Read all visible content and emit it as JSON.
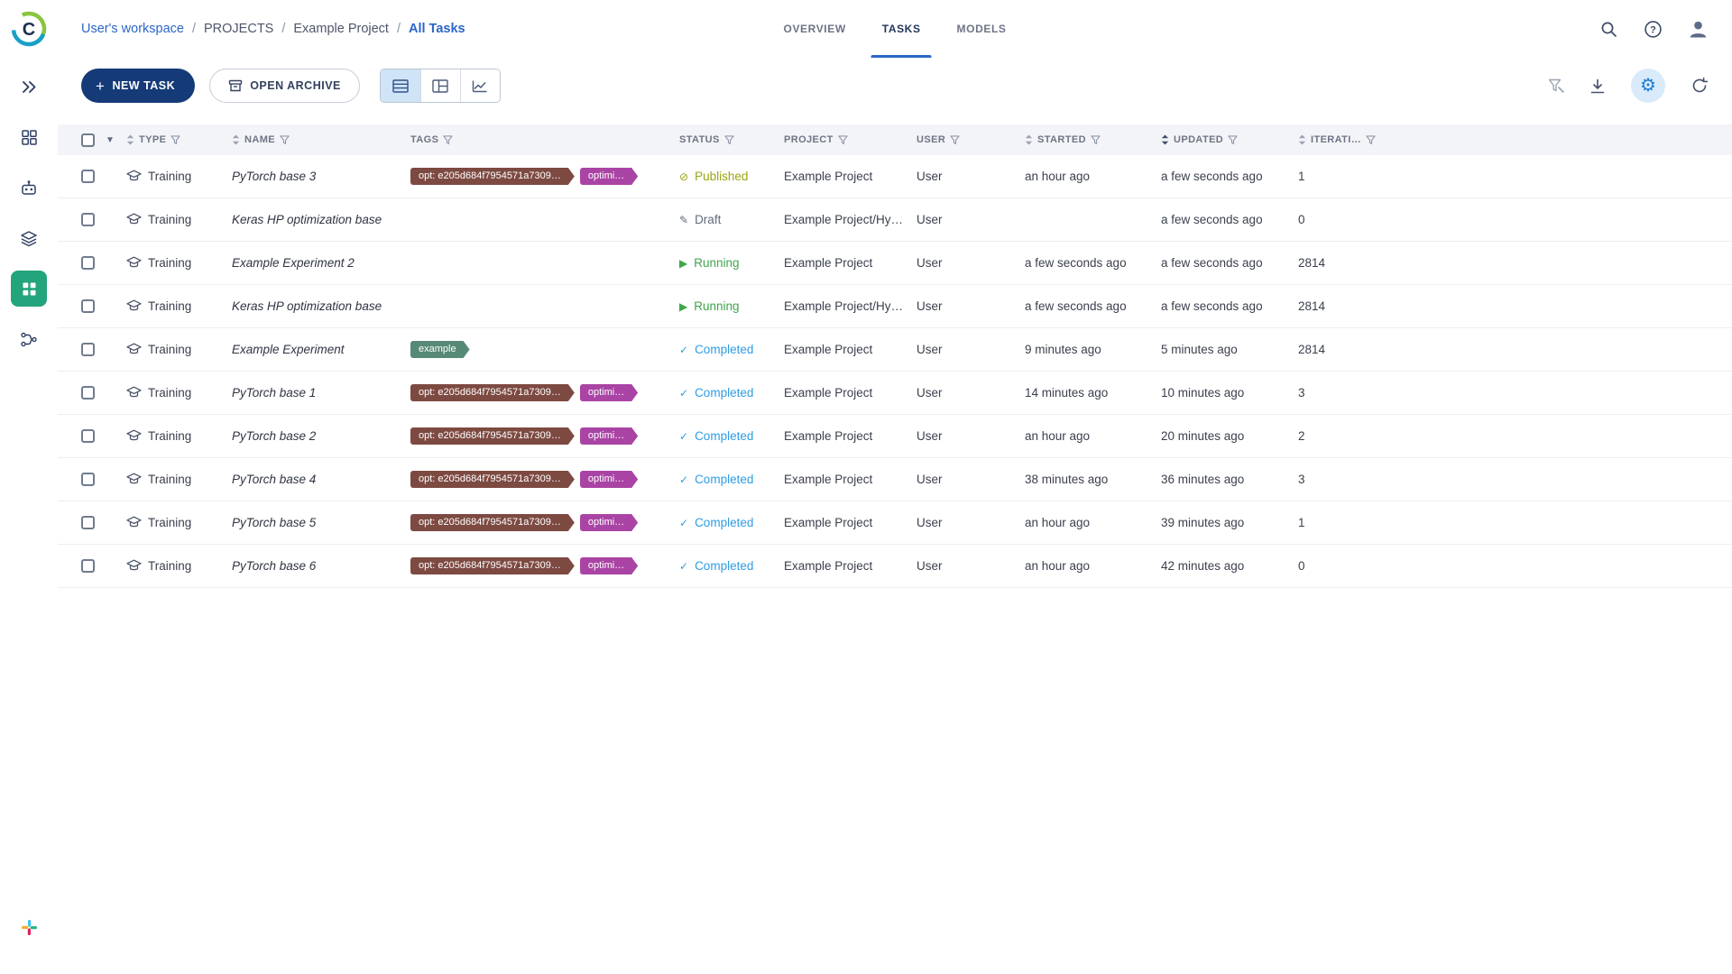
{
  "colors": {
    "link_blue": "#2b66c9",
    "primary_button": "#153a78",
    "active_nav": "#23a47c",
    "table_header_bg": "#f3f4f7",
    "gear_active": "#1f7dd4"
  },
  "sidebar": {
    "items": [
      {
        "name": "expand-sidebar",
        "active": false
      },
      {
        "name": "dashboard",
        "active": false
      },
      {
        "name": "agents",
        "active": false
      },
      {
        "name": "datasets",
        "active": false
      },
      {
        "name": "projects",
        "active": true
      },
      {
        "name": "pipelines",
        "active": false
      }
    ]
  },
  "breadcrumb": {
    "separator": "/",
    "items": [
      {
        "label": "User's workspace",
        "style": "link"
      },
      {
        "label": "PROJECTS",
        "style": "plain"
      },
      {
        "label": "Example Project",
        "style": "plain"
      },
      {
        "label": "All Tasks",
        "style": "current"
      }
    ]
  },
  "tabs": [
    {
      "label": "OVERVIEW",
      "active": false
    },
    {
      "label": "TASKS",
      "active": true
    },
    {
      "label": "MODELS",
      "active": false
    }
  ],
  "toolbar": {
    "new_task_label": "NEW TASK",
    "open_archive_label": "OPEN ARCHIVE"
  },
  "statuses": {
    "Published": {
      "color": "#9ba513",
      "icon": "⊘"
    },
    "Draft": {
      "color": "#636a7e",
      "icon": "✎"
    },
    "Running": {
      "color": "#3fa54a",
      "icon": "▶"
    },
    "Completed": {
      "color": "#2e9ce4",
      "icon": "✓"
    }
  },
  "table": {
    "active_sort_column": "UPDATED",
    "columns": [
      {
        "label": "TYPE",
        "sortable": true,
        "filterable": true
      },
      {
        "label": "NAME",
        "sortable": true,
        "filterable": true
      },
      {
        "label": "TAGS",
        "sortable": false,
        "filterable": true
      },
      {
        "label": "STATUS",
        "sortable": false,
        "filterable": true
      },
      {
        "label": "PROJECT",
        "sortable": false,
        "filterable": true
      },
      {
        "label": "USER",
        "sortable": false,
        "filterable": true
      },
      {
        "label": "STARTED",
        "sortable": true,
        "filterable": true
      },
      {
        "label": "UPDATED",
        "sortable": true,
        "filterable": true
      },
      {
        "label": "ITERATI…",
        "sortable": true,
        "filterable": true
      }
    ],
    "rows": [
      {
        "type": "Training",
        "name": "PyTorch base 3",
        "tags": [
          {
            "label": "opt: e205d684f7954571a7309…",
            "color": "#7d4a42"
          },
          {
            "label": "optimi…",
            "color": "#aa44a4"
          }
        ],
        "status": "Published",
        "project": "Example Project",
        "user": "User",
        "started": "an hour ago",
        "updated": "a few seconds ago",
        "iterations": "1"
      },
      {
        "type": "Training",
        "name": "Keras HP optimization base",
        "tags": [],
        "status": "Draft",
        "project": "Example Project/Hy…",
        "user": "User",
        "started": "",
        "updated": "a few seconds ago",
        "iterations": "0"
      },
      {
        "type": "Training",
        "name": "Example Experiment 2",
        "tags": [],
        "status": "Running",
        "project": "Example Project",
        "user": "User",
        "started": "a few seconds ago",
        "updated": "a few seconds ago",
        "iterations": "2814"
      },
      {
        "type": "Training",
        "name": "Keras HP optimization base",
        "tags": [],
        "status": "Running",
        "project": "Example Project/Hy…",
        "user": "User",
        "started": "a few seconds ago",
        "updated": "a few seconds ago",
        "iterations": "2814"
      },
      {
        "type": "Training",
        "name": "Example Experiment",
        "tags": [
          {
            "label": "example",
            "color": "#578a76"
          }
        ],
        "status": "Completed",
        "project": "Example Project",
        "user": "User",
        "started": "9 minutes ago",
        "updated": "5 minutes ago",
        "iterations": "2814"
      },
      {
        "type": "Training",
        "name": "PyTorch base 1",
        "tags": [
          {
            "label": "opt: e205d684f7954571a7309…",
            "color": "#7d4a42"
          },
          {
            "label": "optimi…",
            "color": "#aa44a4"
          }
        ],
        "status": "Completed",
        "project": "Example Project",
        "user": "User",
        "started": "14 minutes ago",
        "updated": "10 minutes ago",
        "iterations": "3"
      },
      {
        "type": "Training",
        "name": "PyTorch base 2",
        "tags": [
          {
            "label": "opt: e205d684f7954571a7309…",
            "color": "#7d4a42"
          },
          {
            "label": "optimi…",
            "color": "#aa44a4"
          }
        ],
        "status": "Completed",
        "project": "Example Project",
        "user": "User",
        "started": "an hour ago",
        "updated": "20 minutes ago",
        "iterations": "2"
      },
      {
        "type": "Training",
        "name": "PyTorch base 4",
        "tags": [
          {
            "label": "opt: e205d684f7954571a7309…",
            "color": "#7d4a42"
          },
          {
            "label": "optimi…",
            "color": "#aa44a4"
          }
        ],
        "status": "Completed",
        "project": "Example Project",
        "user": "User",
        "started": "38 minutes ago",
        "updated": "36 minutes ago",
        "iterations": "3"
      },
      {
        "type": "Training",
        "name": "PyTorch base 5",
        "tags": [
          {
            "label": "opt: e205d684f7954571a7309…",
            "color": "#7d4a42"
          },
          {
            "label": "optimi…",
            "color": "#aa44a4"
          }
        ],
        "status": "Completed",
        "project": "Example Project",
        "user": "User",
        "started": "an hour ago",
        "updated": "39 minutes ago",
        "iterations": "1"
      },
      {
        "type": "Training",
        "name": "PyTorch base 6",
        "tags": [
          {
            "label": "opt: e205d684f7954571a7309…",
            "color": "#7d4a42"
          },
          {
            "label": "optimi…",
            "color": "#aa44a4"
          }
        ],
        "status": "Completed",
        "project": "Example Project",
        "user": "User",
        "started": "an hour ago",
        "updated": "42 minutes ago",
        "iterations": "0"
      }
    ]
  }
}
